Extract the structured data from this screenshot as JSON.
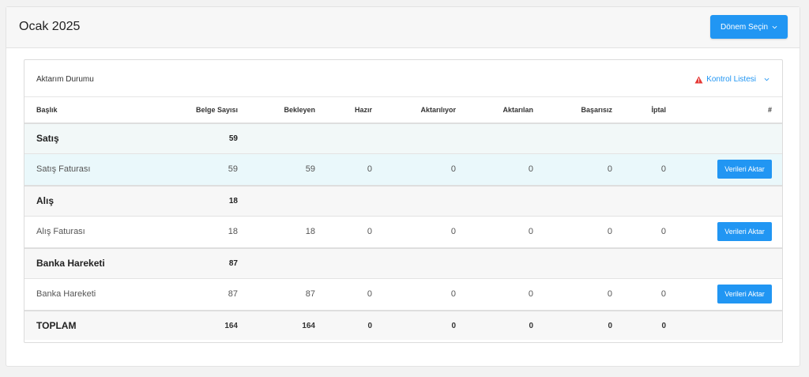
{
  "header": {
    "title": "Ocak 2025",
    "period_button": "Dönem Seçin"
  },
  "panel": {
    "title": "Aktarım Durumu",
    "checklist_link": "Kontrol Listesi"
  },
  "columns": [
    "Başlık",
    "Belge Sayısı",
    "Bekleyen",
    "Hazır",
    "Aktarılıyor",
    "Aktarılan",
    "Başarısız",
    "İptal",
    "#"
  ],
  "groups": [
    {
      "name": "Satış",
      "count": "59",
      "item": {
        "name": "Satış Faturası",
        "belge": "59",
        "bekleyen": "59",
        "hazir": "0",
        "aktariliyor": "0",
        "aktarilan": "0",
        "basarisiz": "0",
        "iptal": "0",
        "action": "Verileri Aktar"
      }
    },
    {
      "name": "Alış",
      "count": "18",
      "item": {
        "name": "Alış Faturası",
        "belge": "18",
        "bekleyen": "18",
        "hazir": "0",
        "aktariliyor": "0",
        "aktarilan": "0",
        "basarisiz": "0",
        "iptal": "0",
        "action": "Verileri Aktar"
      }
    },
    {
      "name": "Banka Hareketi",
      "count": "87",
      "item": {
        "name": "Banka Hareketi",
        "belge": "87",
        "bekleyen": "87",
        "hazir": "0",
        "aktariliyor": "0",
        "aktarilan": "0",
        "basarisiz": "0",
        "iptal": "0",
        "action": "Verileri Aktar"
      }
    }
  ],
  "total": {
    "label": "TOPLAM",
    "belge": "164",
    "bekleyen": "164",
    "hazir": "0",
    "aktariliyor": "0",
    "aktarilan": "0",
    "basarisiz": "0",
    "iptal": "0"
  },
  "colors": {
    "accent": "#2196f3",
    "warning": "#e53935"
  },
  "icons": {
    "period_button": "chevron-down-icon",
    "checklist_warning": "warning-triangle-icon",
    "checklist_chevron": "chevron-down-icon"
  }
}
